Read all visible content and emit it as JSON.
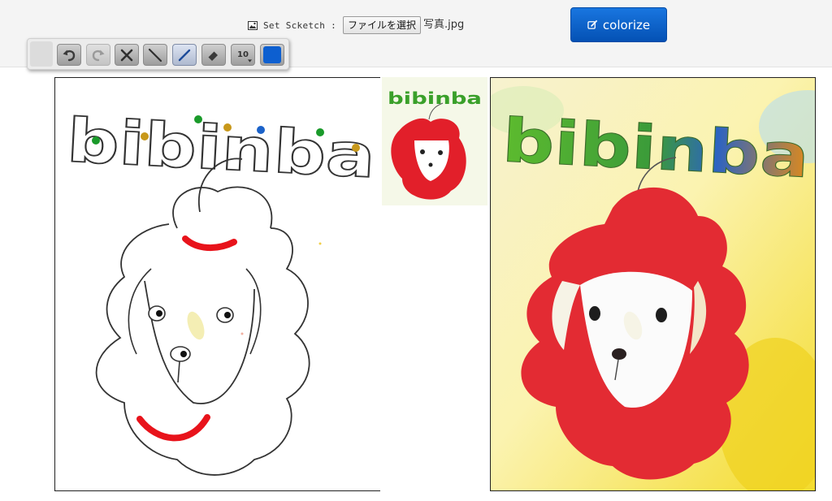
{
  "header": {
    "sketch_label": "Set Scketch :",
    "file_button_label": "ファイルを選択",
    "file_name": "写真.jpg",
    "colorize_label": "colorize"
  },
  "toolbar": {
    "pen_size": "10",
    "tools": [
      {
        "name": "undo-icon",
        "state": "enabled"
      },
      {
        "name": "redo-icon",
        "state": "disabled"
      },
      {
        "name": "clear-icon",
        "state": "enabled"
      },
      {
        "name": "line-icon",
        "state": "enabled"
      },
      {
        "name": "pen-icon",
        "state": "active"
      },
      {
        "name": "eraser-icon",
        "state": "enabled"
      }
    ],
    "current_color": "#0d5fd0"
  },
  "images": {
    "sketch_text": "bibinba",
    "colorized_text": "bibinba",
    "thumbnail_text": "bibinba"
  },
  "colors": {
    "accent": "#0a5bc4",
    "hint_red": "#e8131b",
    "hint_green": "#1a9a2a",
    "hint_gold": "#c8981a",
    "hint_blue": "#1b62c9",
    "result_red": "#e32b33",
    "result_yellow": "#f6e23a"
  }
}
